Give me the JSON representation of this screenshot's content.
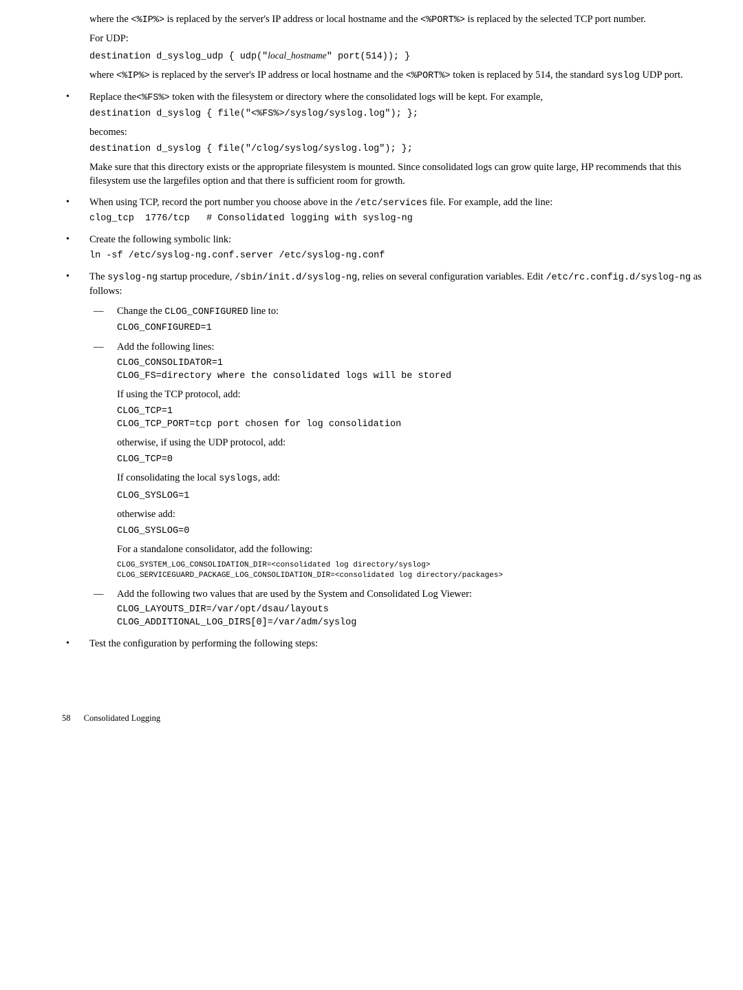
{
  "top": {
    "p1a": "where the ",
    "p1b": " is replaced by the server's IP address or local hostname and the ",
    "p1c": " is replaced by the selected TCP port number.",
    "ip": "<%IP%>",
    "port": "<%PORT%>",
    "forudp": "For UDP:",
    "udpcode_a": "destination d_syslog_udp { udp(\"",
    "udpcode_host": "local_hostname",
    "udpcode_b": "\" port(514)); }",
    "p2a": "where ",
    "p2b": " is replaced by the server's IP address or local hostname and the ",
    "p2c": " token is replaced by 514, the standard ",
    "p2d": " UDP port.",
    "syslog": "syslog"
  },
  "b1": {
    "l1a": "Replace the",
    "fs": "<%FS%>",
    "l1b": " token with the filesystem or directory where the consolidated logs will be kept. For example,",
    "code1": "destination d_syslog { file(\"<%FS%>/syslog/syslog.log\"); };",
    "becomes": "becomes:",
    "code2": "destination d_syslog { file(\"/clog/syslog/syslog.log\"); };",
    "para": "Make sure that this directory exists or the appropriate filesystem is mounted. Since consolidated logs can grow quite large, HP recommends that this filesystem use the largefiles option and that there is sufficient room for growth."
  },
  "b2": {
    "l1a": "When using TCP, record the port number you choose above in the ",
    "svc": "/etc/services",
    "l1b": " file. For example, add the line:",
    "code": "clog_tcp  1776/tcp   # Consolidated logging with syslog-ng"
  },
  "b3": {
    "l1": "Create the following symbolic link:",
    "code": "ln -sf /etc/syslog-ng.conf.server /etc/syslog-ng.conf"
  },
  "b4": {
    "l1a": "The ",
    "sng": "syslog-ng",
    "l1b": " startup procedure, ",
    "init": "/sbin/init.d/syslog-ng",
    "l1c": ", relies on several configuration variables. Edit ",
    "rc": "/etc/rc.config.d/syslog-ng",
    "l1d": " as follows:",
    "d1": {
      "a": "Change the ",
      "cc": "CLOG_CONFIGURED",
      "b": " line to:",
      "code": "CLOG_CONFIGURED=1"
    },
    "d2": {
      "head": "Add the following lines:",
      "code1": "CLOG_CONSOLIDATOR=1\nCLOG_FS=directory where the consolidated logs will be stored",
      "tcp_label": "If using the TCP protocol, add:",
      "code2": "CLOG_TCP=1\nCLOG_TCP_PORT=tcp port chosen for log consolidation",
      "udp_label": "otherwise, if using the UDP protocol, add:",
      "code3": "CLOG_TCP=0",
      "consol_a": "If consolidating the local ",
      "syslogs": "syslogs",
      "consol_b": ", add:",
      "code4": "CLOG_SYSLOG=1",
      "otherwise": "otherwise add:",
      "code5": "CLOG_SYSLOG=0",
      "standalone": "For a standalone consolidator, add the following:",
      "code6": "CLOG_SYSTEM_LOG_CONSOLIDATION_DIR=<consolidated log directory/syslog>\nCLOG_SERVICEGUARD_PACKAGE_LOG_CONSOLIDATION_DIR=<consolidated log directory/packages>"
    },
    "d3": {
      "head": "Add the following two values that are used by the System and Consolidated Log Viewer:",
      "code": "CLOG_LAYOUTS_DIR=/var/opt/dsau/layouts\nCLOG_ADDITIONAL_LOG_DIRS[0]=/var/adm/syslog"
    }
  },
  "b5": {
    "l1": "Test the configuration by performing the following steps:"
  },
  "footer": {
    "page": "58",
    "section": "Consolidated Logging"
  }
}
